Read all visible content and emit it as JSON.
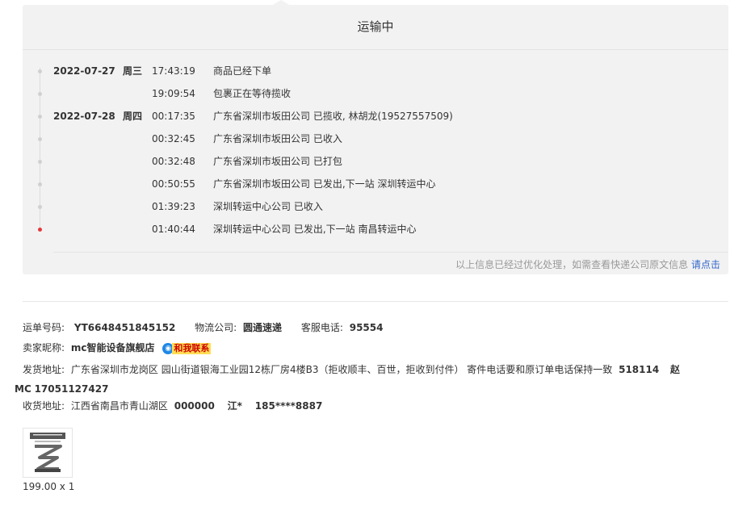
{
  "status_title": "运输中",
  "timeline": [
    {
      "date": "2022-07-27",
      "weekday": "周三",
      "time": "17:43:19",
      "desc": "商品已经下单"
    },
    {
      "date": "",
      "weekday": "",
      "time": "19:09:54",
      "desc": "包裹正在等待揽收"
    },
    {
      "date": "2022-07-28",
      "weekday": "周四",
      "time": "00:17:35",
      "desc": "广东省深圳市坂田公司 已揽收, 林胡龙(19527557509)"
    },
    {
      "date": "",
      "weekday": "",
      "time": "00:32:45",
      "desc": "广东省深圳市坂田公司 已收入"
    },
    {
      "date": "",
      "weekday": "",
      "time": "00:32:48",
      "desc": "广东省深圳市坂田公司 已打包"
    },
    {
      "date": "",
      "weekday": "",
      "time": "00:50:55",
      "desc": "广东省深圳市坂田公司 已发出,下一站 深圳转运中心"
    },
    {
      "date": "",
      "weekday": "",
      "time": "01:39:23",
      "desc": "深圳转运中心公司 已收入"
    },
    {
      "date": "",
      "weekday": "",
      "time": "01:40:44",
      "desc": "深圳转运中心公司 已发出,下一站 南昌转运中心"
    }
  ],
  "note": {
    "text": "以上信息已经过优化处理，如需查看快递公司原文信息 ",
    "link": "请点击"
  },
  "shipment": {
    "order_label": "运单号码:",
    "order_value": "YT6648451845152",
    "carrier_label": "物流公司:",
    "carrier_value": "圆通速递",
    "phone_label": "客服电话:",
    "phone_value": "95554"
  },
  "seller": {
    "label": "卖家昵称:",
    "name": "mc智能设备旗舰店",
    "contact_badge": "和我联系"
  },
  "ship_from": {
    "label": "发货地址:",
    "address": "广东省深圳市龙岗区 园山街道银海工业园12栋厂房4楼B3（拒收顺丰、百世，拒收到付件） 寄件电话要和原订单电话保持一致",
    "postcode": "518114",
    "name": "赵MC",
    "phone": "17051127427"
  },
  "ship_to": {
    "label": "收货地址:",
    "address": "江西省南昌市青山湖区",
    "postcode": "000000",
    "name": "江*",
    "phone": "185****8887"
  },
  "product": {
    "price_qty": "199.00 x 1"
  },
  "colors": {
    "active_dot": "#e4393c",
    "link": "#3366cc",
    "badge_bg": "#ffdd55",
    "qq_blue": "#1e88e5"
  }
}
